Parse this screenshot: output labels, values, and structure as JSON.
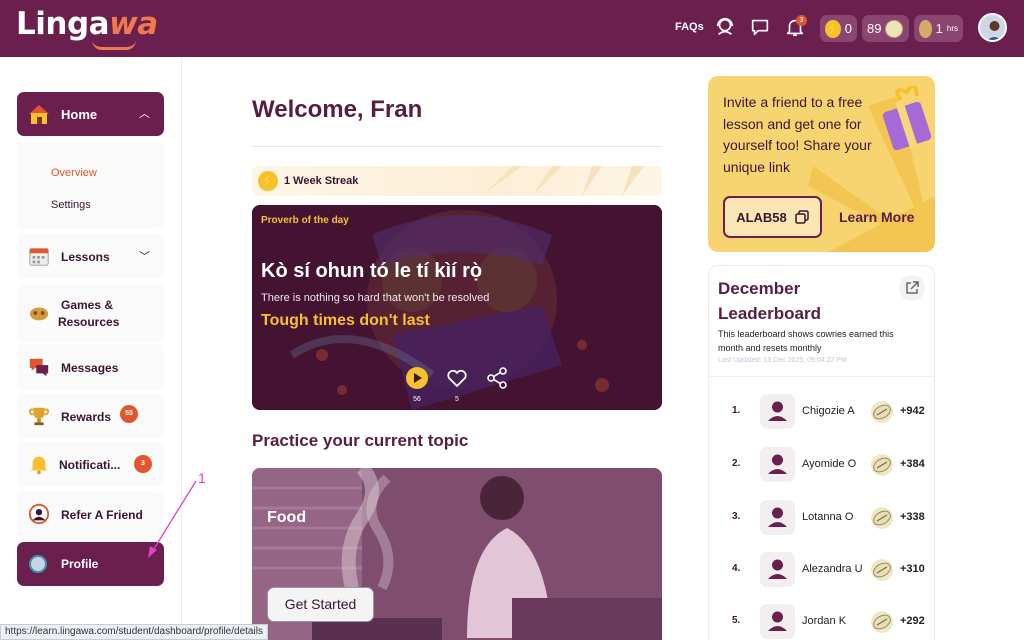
{
  "brand": {
    "name_main": "Linga",
    "name_accent": "wa"
  },
  "topbar": {
    "faqs": "FAQs",
    "notification_count": "3",
    "lightning_count": "0",
    "cowrie_count": "89",
    "hours_value": "1",
    "hours_unit": "hrs"
  },
  "sidebar": {
    "home": "Home",
    "overview": "Overview",
    "settings": "Settings",
    "lessons": "Lessons",
    "games_line1": "Games &",
    "games_line2": "Resources",
    "messages": "Messages",
    "rewards": "Rewards",
    "rewards_badge": "55",
    "notifications": "Notificati...",
    "notifications_badge": "3",
    "refer": "Refer A Friend",
    "profile": "Profile"
  },
  "status_url": "https://learn.lingawa.com/student/dashboard/profile/details",
  "annotation": {
    "number": "1",
    "color": "#e040c6"
  },
  "main": {
    "welcome": "Welcome, Fran",
    "streak": "1 Week Streak",
    "proverb_header": "Proverb of the day",
    "proverb_yoruba": "Kò sí ohun tó le tí kìí rọ̀",
    "proverb_meaning": "There is nothing so hard that won't be resolved",
    "proverb_english": "Tough times don't last",
    "plays": "56",
    "likes": "5",
    "practice_title": "Practice your current topic",
    "topic": "Food",
    "get_started": "Get Started"
  },
  "invite": {
    "text": "Invite a friend to a free lesson and get one for yourself too! Share your unique link",
    "code": "ALAB58",
    "learn_more": "Learn More"
  },
  "leaderboard": {
    "title": "December Leaderboard",
    "desc": "This leaderboard shows cowries earned this month and resets monthly",
    "updated": "Last Updated: 13 Dec 2025, 09:04:22 PM",
    "rows": [
      {
        "rank": "1.",
        "name": "Chigozie A",
        "points": "+942"
      },
      {
        "rank": "2.",
        "name": "Ayomide O",
        "points": "+384"
      },
      {
        "rank": "3.",
        "name": "Lotanna O",
        "points": "+338"
      },
      {
        "rank": "4.",
        "name": "Alezandra U",
        "points": "+310"
      },
      {
        "rank": "5.",
        "name": "Jordan K",
        "points": "+292"
      }
    ]
  },
  "colors": {
    "brand": "#6b1f4e",
    "accent": "#f07a4f",
    "yellow": "#f5c22d",
    "badge": "#e0562e"
  }
}
